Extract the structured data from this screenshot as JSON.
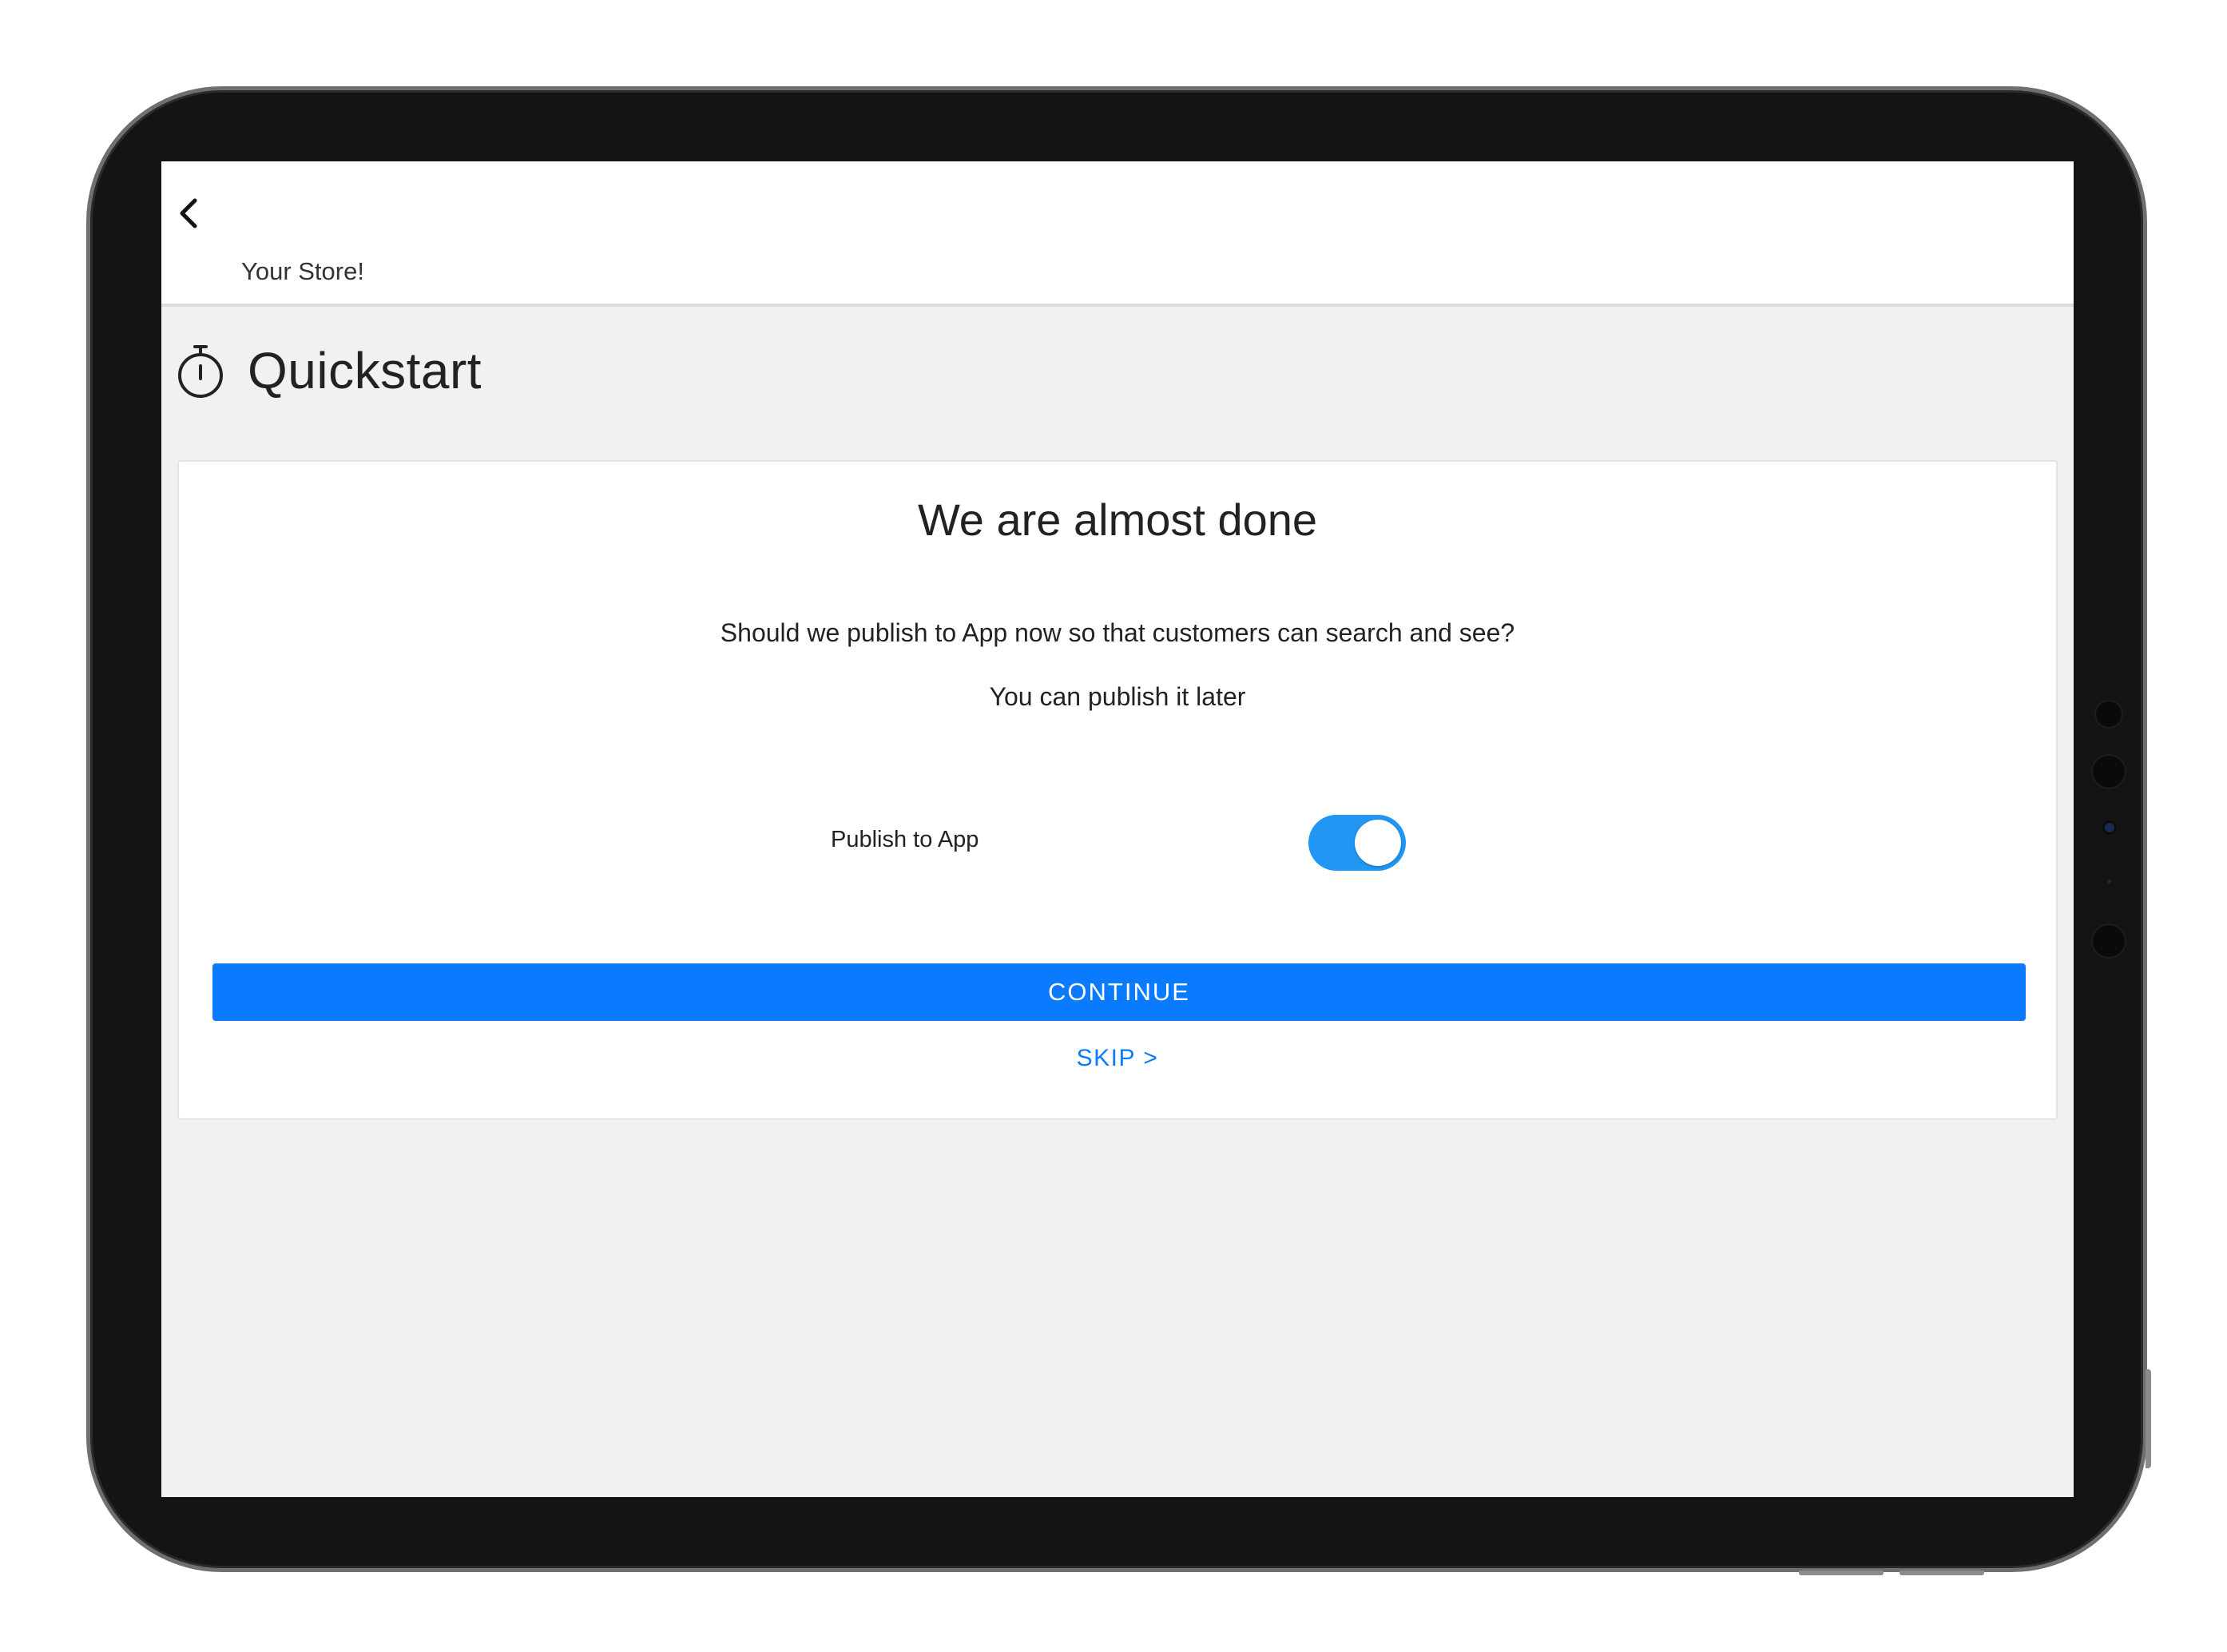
{
  "header": {
    "store_name": "Your Store!"
  },
  "page": {
    "title": "Quickstart",
    "icon": "stopwatch-icon"
  },
  "card": {
    "title": "We are almost done",
    "question": "Should we publish to App now so that customers can search and see?",
    "hint": "You can publish it later",
    "toggle_label": "Publish to App",
    "toggle_on": true,
    "continue_label": "CONTINUE",
    "skip_label": "SKIP >"
  },
  "colors": {
    "primary": "#0a7aff",
    "toggle_active": "#2196f3",
    "background": "#f0f1f3"
  }
}
